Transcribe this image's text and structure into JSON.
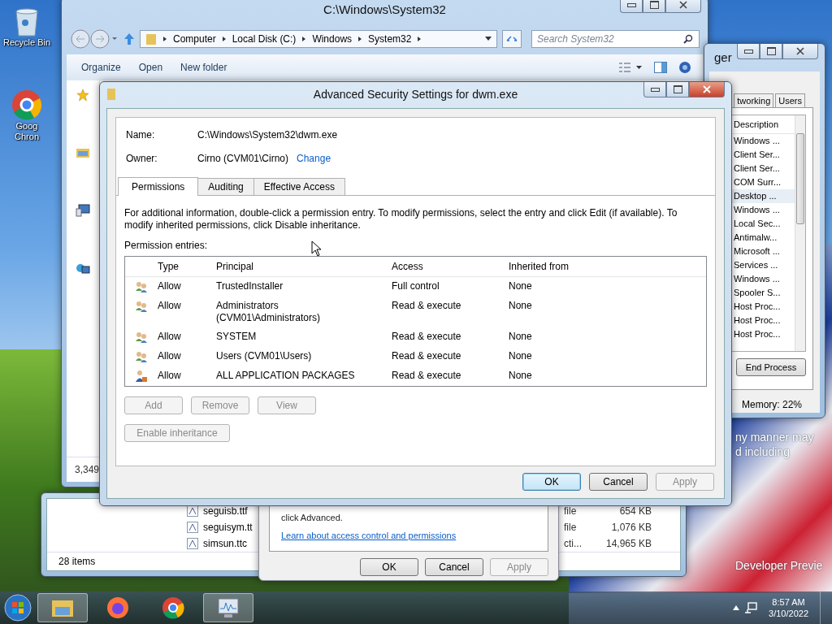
{
  "desktop_icons": [
    {
      "kind": "recycle",
      "lines": [
        "Recycle Bin"
      ]
    },
    {
      "kind": "chrome",
      "lines": [
        "Goog",
        "Chron"
      ]
    }
  ],
  "explorer": {
    "title": "C:\\Windows\\System32",
    "breadcrumb": [
      "Computer",
      "Local Disk (C:)",
      "Windows",
      "System32"
    ],
    "search": {
      "placeholder": "Search System32"
    },
    "toolbar": [
      "Organize",
      "Open",
      "New folder"
    ],
    "status": "3,349"
  },
  "explorer_back": {
    "files": [
      {
        "name": "seguisb.ttf",
        "type": "file",
        "size": "654 KB"
      },
      {
        "name": "seguisym.tt",
        "type": "file",
        "size": "1,076 KB"
      },
      {
        "name": "simsun.ttc",
        "type": "cti...",
        "size": "14,965 KB"
      }
    ],
    "status": "28 items"
  },
  "properties": {
    "text": "click Advanced.",
    "link": "Learn about access control and permissions",
    "buttons": [
      {
        "label": "OK",
        "disabled": false
      },
      {
        "label": "Cancel",
        "disabled": false
      },
      {
        "label": "Apply",
        "disabled": true
      }
    ]
  },
  "task_manager": {
    "title": "ger",
    "tabs": [
      {
        "label": "tworking",
        "selected": false
      },
      {
        "label": "Users",
        "selected": false
      }
    ],
    "column": "Description",
    "rows": [
      {
        "label": "Windows ...",
        "selected": false
      },
      {
        "label": "Client Ser...",
        "selected": false
      },
      {
        "label": "Client Ser...",
        "selected": false
      },
      {
        "label": "COM Surr...",
        "selected": false
      },
      {
        "label": "Desktop ...",
        "selected": true
      },
      {
        "label": "Windows ...",
        "selected": false
      },
      {
        "label": "Local Sec...",
        "selected": false
      },
      {
        "label": "Antimalw...",
        "selected": false
      },
      {
        "label": "Microsoft ...",
        "selected": false
      },
      {
        "label": "Services ...",
        "selected": false
      },
      {
        "label": "Windows ...",
        "selected": false
      },
      {
        "label": "Spooler S...",
        "selected": false
      },
      {
        "label": "Host Proc...",
        "selected": false
      },
      {
        "label": "Host Proc...",
        "selected": false
      },
      {
        "label": "Host Proc...",
        "selected": false
      }
    ],
    "button": "End Process",
    "status": "Memory: 22%"
  },
  "wallpaper_texts": [
    "ny manner may",
    "d including",
    "Developer Previe"
  ],
  "dialog": {
    "title": "Advanced Security Settings for dwm.exe",
    "name_label": "Name:",
    "name_value": "C:\\Windows\\System32\\dwm.exe",
    "owner_label": "Owner:",
    "owner_value": "Cirno (CVM01\\Cirno)",
    "change_link": "Change",
    "tabs": [
      {
        "label": "Permissions",
        "selected": true
      },
      {
        "label": "Auditing",
        "selected": false
      },
      {
        "label": "Effective Access",
        "selected": false
      }
    ],
    "info": "For additional information, double-click a permission entry. To modify permissions, select the entry and click Edit (if available). To modify inherited permissions, click Disable inheritance.",
    "entries_label": "Permission entries:",
    "columns": [
      "Type",
      "Principal",
      "Access",
      "Inherited from"
    ],
    "rows": [
      {
        "kind": "group",
        "type": "Allow",
        "principal": "TrustedInstaller",
        "access": "Full control",
        "inherited_from": "None"
      },
      {
        "kind": "group",
        "type": "Allow",
        "principal": "Administrators (CVM01\\Administrators)",
        "access": "Read & execute",
        "inherited_from": "None"
      },
      {
        "kind": "group",
        "type": "Allow",
        "principal": "SYSTEM",
        "access": "Read & execute",
        "inherited_from": "None"
      },
      {
        "kind": "group",
        "type": "Allow",
        "principal": "Users (CVM01\\Users)",
        "access": "Read & execute",
        "inherited_from": "None"
      },
      {
        "kind": "package",
        "type": "Allow",
        "principal": "ALL APPLICATION PACKAGES",
        "access": "Read & execute",
        "inherited_from": "None"
      }
    ],
    "entry_buttons": [
      {
        "label": "Add",
        "disabled": true
      },
      {
        "label": "Remove",
        "disabled": true
      },
      {
        "label": "View",
        "disabled": true
      }
    ],
    "inheritance_button": {
      "label": "Enable inheritance",
      "disabled": true
    },
    "footer_buttons": [
      {
        "label": "OK",
        "disabled": false,
        "default": true
      },
      {
        "label": "Cancel",
        "disabled": false,
        "default": false
      },
      {
        "label": "Apply",
        "disabled": true,
        "default": false
      }
    ]
  },
  "taskbar": {
    "apps": [
      {
        "kind": "explorer",
        "active": true
      },
      {
        "kind": "firefox",
        "active": false
      },
      {
        "kind": "chrome",
        "active": false
      },
      {
        "kind": "taskmgr",
        "active": true
      }
    ],
    "time": "8:57 AM",
    "date": "3/10/2022"
  }
}
